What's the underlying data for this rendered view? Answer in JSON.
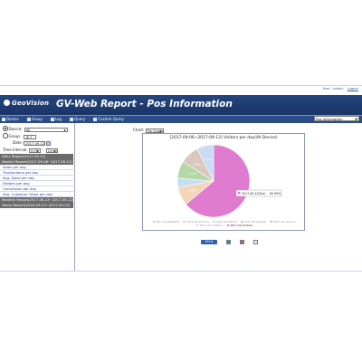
{
  "app": {
    "brand": "GeoVision",
    "title": "GV-Web Report - Pos Information",
    "user_bar": {
      "user": "User : admin",
      "logout": "Logout"
    }
  },
  "menu": [
    {
      "label": "Device",
      "icon": "device-icon"
    },
    {
      "label": "Group",
      "icon": "group-icon"
    },
    {
      "label": "Log",
      "icon": "log-icon"
    },
    {
      "label": "Query",
      "icon": "query-icon"
    },
    {
      "label": "Custom Query",
      "icon": "custom-query-icon"
    }
  ],
  "report_select": {
    "value": "Pos Information"
  },
  "filters": {
    "device_label": "Device:",
    "device_value": "All",
    "group_label": "Group:",
    "group_value": "全 V",
    "date_label": "Date:",
    "date_value": "2017-09-12",
    "time_interval_label": "Time Interval:",
    "time_from": "0:00",
    "time_to": "23:00",
    "selected": "device"
  },
  "sidebar": {
    "groups": [
      {
        "header": "Daily Report(2017-09-12)",
        "items": []
      },
      {
        "header": "Weekly Report(2017-09-06~2017-09-12)",
        "items": [
          "Sales per day",
          "Transactions per day",
          "Avg. Sales per day",
          "Visitors per day",
          "Conversion per day",
          "Avg. Customer Value per day"
        ]
      },
      {
        "header": "Monthly Report(2017-08-13~2017-09-12)",
        "items": []
      },
      {
        "header": "Yearly Report(2016-09-13~2017-09-12)",
        "items": []
      }
    ]
  },
  "chart_controls": {
    "label": "Chart:",
    "value": "Pie Graph"
  },
  "chart_data": {
    "type": "pie",
    "title": "[2017-09-06~2017-09-12] Visitors per day(All Device)",
    "categories": [
      "2017-09-06(Wed)",
      "2017-09-07(Thu)",
      "2017-09-08(Fri)",
      "2017-09-09(Sat)",
      "2017-09-10(Sun)",
      "2017-09-11(Mon)",
      "2017-09-12(Tue)"
    ],
    "values": [
      0.0,
      8.29,
      4.03,
      7.75,
      8.54,
      7.49,
      63.9
    ],
    "slice_labels": [
      "",
      "8.29%",
      "",
      "7.75%",
      "8.54%",
      "7.49%",
      ""
    ],
    "colors": [
      "#d7d0c6",
      "#f5d5b9",
      "#c3e0f2",
      "#b6d8a7",
      "#d9c8bd",
      "#c9dcf2",
      "#e07ccf"
    ],
    "highlighted": {
      "category": "2017-09-12(Tue)",
      "label": "63.99%"
    },
    "legend_position": "bottom"
  },
  "actions": {
    "print_label": "Print",
    "icons": [
      "excel-export-icon",
      "pdf-export-icon",
      "email-icon"
    ]
  }
}
